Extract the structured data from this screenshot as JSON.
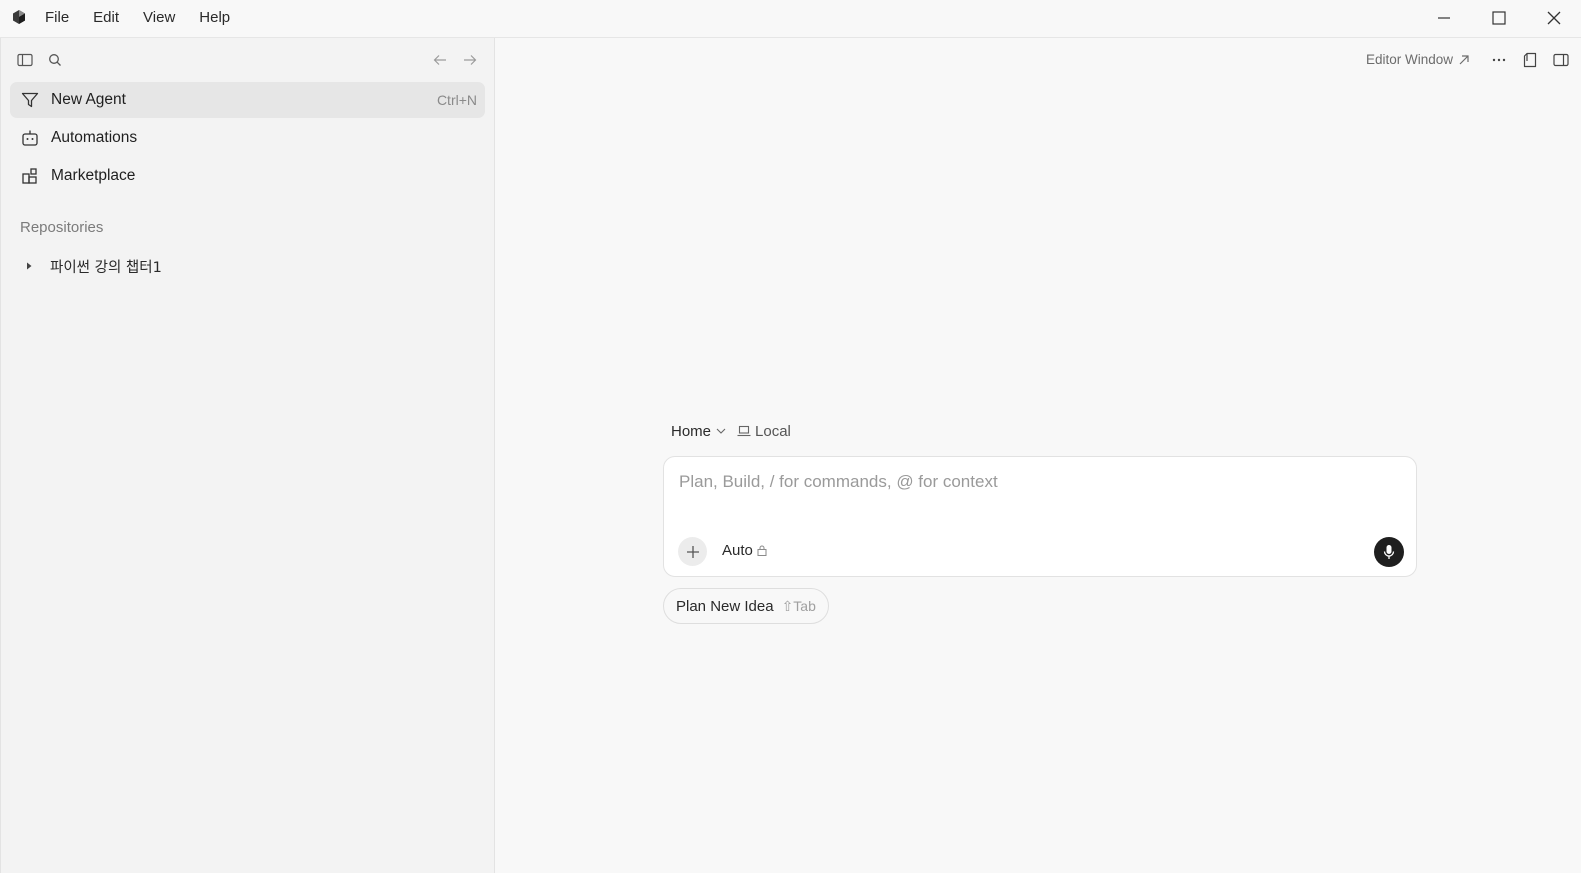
{
  "menu": {
    "items": [
      "File",
      "Edit",
      "View",
      "Help"
    ]
  },
  "sidebar": {
    "nav": [
      {
        "label": "New Agent",
        "shortcut": "Ctrl+N",
        "icon": "agent-icon"
      },
      {
        "label": "Automations",
        "icon": "robot-icon"
      },
      {
        "label": "Marketplace",
        "icon": "marketplace-icon"
      }
    ],
    "section_label": "Repositories",
    "repos": [
      {
        "label": "파이썬 강의 챕터1"
      }
    ]
  },
  "header": {
    "editor_window_label": "Editor Window"
  },
  "composer": {
    "context_home": "Home",
    "context_local": "Local",
    "placeholder": "Plan, Build, / for commands, @ for context",
    "mode_label": "Auto"
  },
  "chip": {
    "label": "Plan New Idea",
    "shortcut": "⇧Tab"
  },
  "colors": {
    "mic_button": "#1f1f1f",
    "active_nav": "#e6e6e6"
  }
}
